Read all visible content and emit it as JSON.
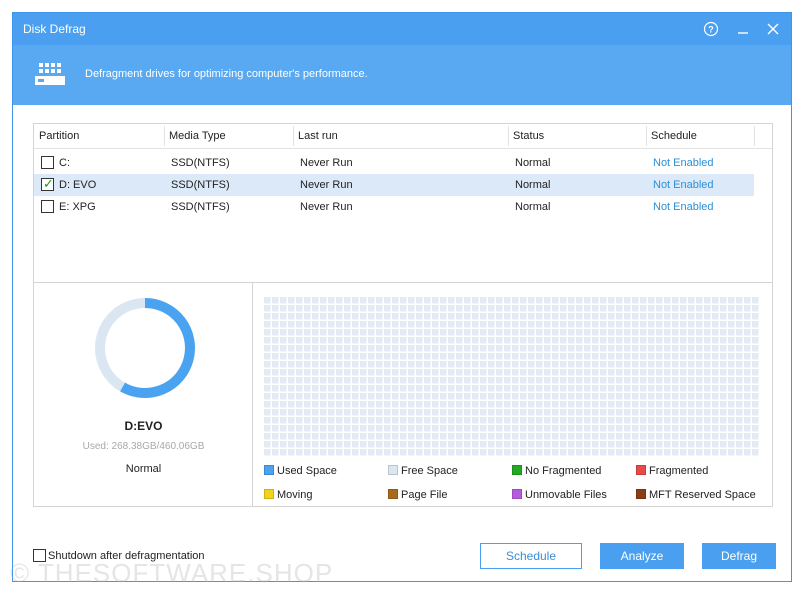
{
  "window": {
    "title": "Disk Defrag"
  },
  "titlebar_icons": {
    "help": "help-icon",
    "minimize": "minimize-icon",
    "close": "close-icon"
  },
  "banner": {
    "text": "Defragment drives for optimizing computer's performance.",
    "icon": "disk-defrag-icon"
  },
  "table": {
    "headers": [
      "Partition",
      "Media Type",
      "Last run",
      "Status",
      "Schedule"
    ],
    "rows": [
      {
        "partition": "C:",
        "media": "SSD(NTFS)",
        "last_run": "Never Run",
        "status": "Normal",
        "schedule": "Not Enabled",
        "checked": false
      },
      {
        "partition": "D:  EVO",
        "media": "SSD(NTFS)",
        "last_run": "Never Run",
        "status": "Normal",
        "schedule": "Not Enabled",
        "checked": true
      },
      {
        "partition": "E:  XPG",
        "media": "SSD(NTFS)",
        "last_run": "Never Run",
        "status": "Normal",
        "schedule": "Not Enabled",
        "checked": false
      }
    ],
    "selected_row": 1
  },
  "drive": {
    "name": "D:EVO",
    "used": "Used: 268.38GB/460.06GB",
    "used_fraction": 0.583,
    "status": "Normal"
  },
  "legend": [
    {
      "label": "Used Space",
      "color": "#4aa3f0"
    },
    {
      "label": "Free Space",
      "color": "#dbe6f3"
    },
    {
      "label": "No Fragmented",
      "color": "#22a822"
    },
    {
      "label": "Fragmented",
      "color": "#e84a4a"
    },
    {
      "label": "Moving",
      "color": "#f2d21a"
    },
    {
      "label": "Page File",
      "color": "#a86a18"
    },
    {
      "label": "Unmovable Files",
      "color": "#b85ae0"
    },
    {
      "label": "MFT Reserved Space",
      "color": "#8a3e18"
    }
  ],
  "colors": {
    "accent": "#4a9ff0",
    "banner": "#58a9f2",
    "link": "#2b8fd6",
    "cluster_free": "#e3eaf4",
    "donut_used": "#4aa3f0",
    "donut_free": "#dbe6f3"
  },
  "footer": {
    "shutdown_label": "Shutdown after defragmentation",
    "shutdown_checked": false,
    "schedule_button": "Schedule",
    "analyze_button": "Analyze",
    "defrag_button": "Defrag"
  },
  "watermark": "© THESOFTWARE.SHOP"
}
